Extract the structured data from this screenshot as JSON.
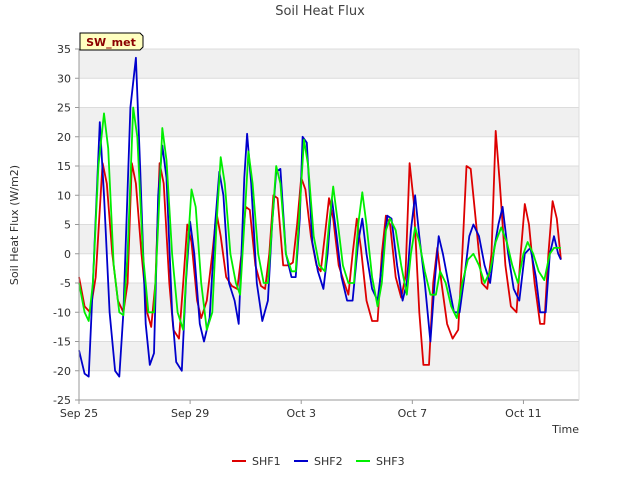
{
  "chart_data": {
    "type": "line",
    "title": "Soil Heat Flux",
    "xlabel": "Time",
    "ylabel": "Soil Heat Flux (W/m2)",
    "station_tag": "SW_met",
    "xlim": [
      0,
      18
    ],
    "ylim": [
      -25,
      35
    ],
    "yticks": [
      -25,
      -20,
      -15,
      -10,
      -5,
      0,
      5,
      10,
      15,
      20,
      25,
      30,
      35
    ],
    "xticks": [
      {
        "x": 0,
        "label": "Sep 25"
      },
      {
        "x": 4,
        "label": "Sep 29"
      },
      {
        "x": 8,
        "label": "Oct 3"
      },
      {
        "x": 12,
        "label": "Oct 7"
      },
      {
        "x": 16,
        "label": "Oct 11"
      }
    ],
    "grid": true,
    "legend_position": "bottom-center",
    "series": [
      {
        "name": "SHF1",
        "color": "#dd0000",
        "points": [
          [
            0.0,
            -4
          ],
          [
            0.2,
            -9
          ],
          [
            0.4,
            -10
          ],
          [
            0.6,
            -4
          ],
          [
            0.85,
            15.5
          ],
          [
            1.0,
            12
          ],
          [
            1.2,
            0
          ],
          [
            1.4,
            -8
          ],
          [
            1.6,
            -10
          ],
          [
            1.75,
            -5
          ],
          [
            1.9,
            15.5
          ],
          [
            2.05,
            12
          ],
          [
            2.25,
            0
          ],
          [
            2.45,
            -10
          ],
          [
            2.6,
            -12.5
          ],
          [
            2.75,
            -5
          ],
          [
            2.9,
            15.5
          ],
          [
            3.05,
            12
          ],
          [
            3.25,
            -5
          ],
          [
            3.4,
            -13
          ],
          [
            3.6,
            -14.5
          ],
          [
            3.75,
            -5
          ],
          [
            3.9,
            5
          ],
          [
            4.05,
            2
          ],
          [
            4.25,
            -8
          ],
          [
            4.4,
            -11
          ],
          [
            4.6,
            -8
          ],
          [
            4.8,
            0
          ],
          [
            4.95,
            7
          ],
          [
            5.1,
            3
          ],
          [
            5.3,
            -4
          ],
          [
            5.5,
            -5.5
          ],
          [
            5.7,
            -6
          ],
          [
            5.85,
            0
          ],
          [
            6.0,
            8
          ],
          [
            6.15,
            7.5
          ],
          [
            6.35,
            -2
          ],
          [
            6.55,
            -5.5
          ],
          [
            6.7,
            -6
          ],
          [
            6.85,
            0
          ],
          [
            7.0,
            10
          ],
          [
            7.15,
            9.5
          ],
          [
            7.35,
            -2
          ],
          [
            7.55,
            -2
          ],
          [
            7.7,
            -1.5
          ],
          [
            7.85,
            5
          ],
          [
            8.0,
            13
          ],
          [
            8.15,
            11
          ],
          [
            8.35,
            3
          ],
          [
            8.55,
            -2
          ],
          [
            8.7,
            -3
          ],
          [
            8.85,
            3
          ],
          [
            9.0,
            9.5
          ],
          [
            9.15,
            6
          ],
          [
            9.35,
            -2
          ],
          [
            9.55,
            -5
          ],
          [
            9.7,
            -7
          ],
          [
            9.85,
            0
          ],
          [
            10.0,
            6
          ],
          [
            10.15,
            1
          ],
          [
            10.35,
            -8
          ],
          [
            10.55,
            -11.5
          ],
          [
            10.75,
            -11.5
          ],
          [
            10.9,
            0
          ],
          [
            11.05,
            6.5
          ],
          [
            11.2,
            5
          ],
          [
            11.4,
            -4
          ],
          [
            11.6,
            -7.5
          ],
          [
            11.75,
            -4
          ],
          [
            11.9,
            15.5
          ],
          [
            12.05,
            9
          ],
          [
            12.25,
            -10
          ],
          [
            12.4,
            -19
          ],
          [
            12.6,
            -19
          ],
          [
            12.75,
            -5
          ],
          [
            12.9,
            1
          ],
          [
            13.05,
            -5
          ],
          [
            13.25,
            -12
          ],
          [
            13.45,
            -14.5
          ],
          [
            13.65,
            -13
          ],
          [
            13.8,
            0
          ],
          [
            13.95,
            15
          ],
          [
            14.1,
            14.5
          ],
          [
            14.3,
            5
          ],
          [
            14.5,
            -5
          ],
          [
            14.7,
            -6
          ],
          [
            14.85,
            0
          ],
          [
            15.0,
            21
          ],
          [
            15.15,
            12
          ],
          [
            15.35,
            -2
          ],
          [
            15.55,
            -9
          ],
          [
            15.75,
            -10
          ],
          [
            15.9,
            0
          ],
          [
            16.05,
            8.5
          ],
          [
            16.2,
            5
          ],
          [
            16.4,
            -5
          ],
          [
            16.6,
            -12
          ],
          [
            16.75,
            -12
          ],
          [
            16.9,
            0
          ],
          [
            17.05,
            9
          ],
          [
            17.2,
            6
          ],
          [
            17.35,
            -1
          ]
        ]
      },
      {
        "name": "SHF2",
        "color": "#0000cc",
        "points": [
          [
            0.0,
            -16.5
          ],
          [
            0.2,
            -20.5
          ],
          [
            0.35,
            -21
          ],
          [
            0.5,
            -5
          ],
          [
            0.75,
            22.5
          ],
          [
            0.9,
            10
          ],
          [
            1.1,
            -10
          ],
          [
            1.3,
            -20
          ],
          [
            1.45,
            -21
          ],
          [
            1.6,
            -10
          ],
          [
            1.85,
            25
          ],
          [
            2.05,
            33.5
          ],
          [
            2.2,
            15
          ],
          [
            2.4,
            -12
          ],
          [
            2.55,
            -19
          ],
          [
            2.7,
            -17
          ],
          [
            2.85,
            10
          ],
          [
            3.0,
            18.5
          ],
          [
            3.15,
            13
          ],
          [
            3.35,
            -10
          ],
          [
            3.5,
            -18.5
          ],
          [
            3.7,
            -20
          ],
          [
            3.85,
            -5
          ],
          [
            4.0,
            5.5
          ],
          [
            4.15,
            0
          ],
          [
            4.35,
            -12
          ],
          [
            4.5,
            -15
          ],
          [
            4.7,
            -11
          ],
          [
            4.9,
            5
          ],
          [
            5.05,
            14
          ],
          [
            5.2,
            10
          ],
          [
            5.4,
            -5
          ],
          [
            5.6,
            -8
          ],
          [
            5.75,
            -12
          ],
          [
            5.85,
            0
          ],
          [
            5.95,
            13
          ],
          [
            6.05,
            20.5
          ],
          [
            6.2,
            12
          ],
          [
            6.4,
            -5
          ],
          [
            6.6,
            -11.5
          ],
          [
            6.8,
            -8
          ],
          [
            6.95,
            5
          ],
          [
            7.1,
            14
          ],
          [
            7.25,
            14.5
          ],
          [
            7.45,
            0
          ],
          [
            7.65,
            -4
          ],
          [
            7.8,
            -4
          ],
          [
            7.95,
            6
          ],
          [
            8.05,
            20
          ],
          [
            8.2,
            19
          ],
          [
            8.4,
            2
          ],
          [
            8.6,
            -3
          ],
          [
            8.8,
            -6
          ],
          [
            8.95,
            0
          ],
          [
            9.1,
            9.5
          ],
          [
            9.25,
            4
          ],
          [
            9.45,
            -4
          ],
          [
            9.65,
            -8
          ],
          [
            9.85,
            -8
          ],
          [
            10.05,
            2
          ],
          [
            10.2,
            6
          ],
          [
            10.35,
            0
          ],
          [
            10.55,
            -6
          ],
          [
            10.75,
            -8
          ],
          [
            10.95,
            0
          ],
          [
            11.1,
            6.5
          ],
          [
            11.25,
            6
          ],
          [
            11.45,
            -2
          ],
          [
            11.65,
            -8
          ],
          [
            11.8,
            -5
          ],
          [
            11.95,
            4
          ],
          [
            12.1,
            10
          ],
          [
            12.25,
            3
          ],
          [
            12.45,
            -5
          ],
          [
            12.65,
            -15
          ],
          [
            12.8,
            -5
          ],
          [
            12.95,
            3
          ],
          [
            13.1,
            0
          ],
          [
            13.3,
            -5
          ],
          [
            13.5,
            -10
          ],
          [
            13.7,
            -10
          ],
          [
            13.9,
            -3
          ],
          [
            14.05,
            3
          ],
          [
            14.2,
            5
          ],
          [
            14.4,
            3
          ],
          [
            14.6,
            -2
          ],
          [
            14.8,
            -5
          ],
          [
            14.95,
            1
          ],
          [
            15.1,
            5
          ],
          [
            15.25,
            8
          ],
          [
            15.45,
            0
          ],
          [
            15.65,
            -6
          ],
          [
            15.85,
            -8
          ],
          [
            16.05,
            0
          ],
          [
            16.25,
            1
          ],
          [
            16.45,
            -4
          ],
          [
            16.6,
            -10
          ],
          [
            16.8,
            -10
          ],
          [
            16.95,
            0
          ],
          [
            17.1,
            3
          ],
          [
            17.25,
            0
          ],
          [
            17.35,
            -1
          ]
        ]
      },
      {
        "name": "SHF3",
        "color": "#00ee00",
        "points": [
          [
            0.0,
            -5
          ],
          [
            0.2,
            -10
          ],
          [
            0.35,
            -11.5
          ],
          [
            0.5,
            -5
          ],
          [
            0.7,
            15
          ],
          [
            0.9,
            24
          ],
          [
            1.05,
            18
          ],
          [
            1.25,
            -2
          ],
          [
            1.45,
            -10
          ],
          [
            1.6,
            -10.5
          ],
          [
            1.75,
            0
          ],
          [
            1.95,
            25
          ],
          [
            2.1,
            20
          ],
          [
            2.3,
            0
          ],
          [
            2.5,
            -10
          ],
          [
            2.7,
            -10
          ],
          [
            2.85,
            5
          ],
          [
            3.0,
            21.5
          ],
          [
            3.15,
            16
          ],
          [
            3.35,
            0
          ],
          [
            3.55,
            -10
          ],
          [
            3.75,
            -13
          ],
          [
            3.9,
            0
          ],
          [
            4.05,
            11
          ],
          [
            4.2,
            8
          ],
          [
            4.4,
            -5
          ],
          [
            4.6,
            -13
          ],
          [
            4.8,
            -10
          ],
          [
            4.95,
            5
          ],
          [
            5.1,
            16.5
          ],
          [
            5.25,
            12
          ],
          [
            5.45,
            0
          ],
          [
            5.65,
            -5
          ],
          [
            5.8,
            -7
          ],
          [
            5.95,
            5
          ],
          [
            6.1,
            17.5
          ],
          [
            6.25,
            12
          ],
          [
            6.45,
            0
          ],
          [
            6.65,
            -5
          ],
          [
            6.8,
            -5
          ],
          [
            6.95,
            5
          ],
          [
            7.1,
            15
          ],
          [
            7.25,
            12
          ],
          [
            7.45,
            0
          ],
          [
            7.65,
            -3
          ],
          [
            7.8,
            -3
          ],
          [
            7.95,
            8
          ],
          [
            8.1,
            19.5
          ],
          [
            8.25,
            15
          ],
          [
            8.45,
            3
          ],
          [
            8.65,
            -2
          ],
          [
            8.85,
            -3
          ],
          [
            9.0,
            5
          ],
          [
            9.15,
            11.5
          ],
          [
            9.3,
            6
          ],
          [
            9.5,
            -2
          ],
          [
            9.7,
            -5
          ],
          [
            9.9,
            -5
          ],
          [
            10.05,
            5
          ],
          [
            10.2,
            10.5
          ],
          [
            10.35,
            5
          ],
          [
            10.55,
            -4
          ],
          [
            10.75,
            -9
          ],
          [
            10.9,
            -5
          ],
          [
            11.05,
            4
          ],
          [
            11.2,
            6
          ],
          [
            11.4,
            4
          ],
          [
            11.6,
            -2
          ],
          [
            11.8,
            -7
          ],
          [
            11.95,
            0
          ],
          [
            12.1,
            4.5
          ],
          [
            12.25,
            2
          ],
          [
            12.45,
            -3
          ],
          [
            12.65,
            -7
          ],
          [
            12.85,
            -7
          ],
          [
            13.0,
            -3
          ],
          [
            13.2,
            -5
          ],
          [
            13.4,
            -9
          ],
          [
            13.6,
            -11
          ],
          [
            13.8,
            -5
          ],
          [
            14.0,
            -1
          ],
          [
            14.2,
            0
          ],
          [
            14.4,
            -2
          ],
          [
            14.6,
            -5
          ],
          [
            14.8,
            -3
          ],
          [
            15.0,
            2
          ],
          [
            15.2,
            4.5
          ],
          [
            15.4,
            2
          ],
          [
            15.6,
            -2
          ],
          [
            15.8,
            -5
          ],
          [
            16.0,
            0
          ],
          [
            16.15,
            2
          ],
          [
            16.35,
            0
          ],
          [
            16.55,
            -3
          ],
          [
            16.75,
            -4.5
          ],
          [
            16.95,
            0
          ],
          [
            17.1,
            1
          ],
          [
            17.35,
            1
          ]
        ]
      }
    ]
  }
}
